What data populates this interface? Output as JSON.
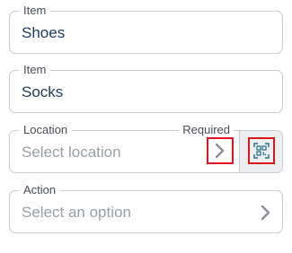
{
  "fields": {
    "item1": {
      "label": "Item",
      "value": "Shoes"
    },
    "item2": {
      "label": "Item",
      "value": "Socks"
    },
    "location": {
      "label": "Location",
      "required": "Required",
      "placeholder": "Select location"
    },
    "action": {
      "label": "Action",
      "placeholder": "Select an option"
    }
  },
  "icons": {
    "chevron": "chevron-right-icon",
    "scan": "qr-scan-icon"
  },
  "colors": {
    "border": "#c9cdd2",
    "value_text": "#1f3a5f",
    "placeholder_text": "#9aa0a6",
    "highlight": "#e0151b",
    "icon": "#8a9096",
    "scan_icon": "#2a6d8f"
  }
}
